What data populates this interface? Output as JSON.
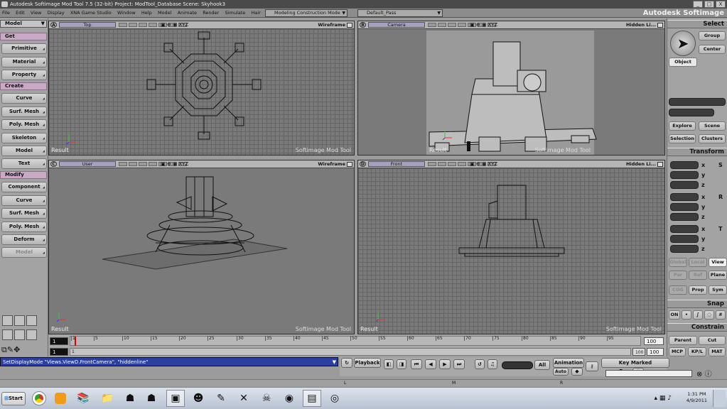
{
  "window": {
    "title": "Autodesk Softimage Mod Tool 7.5 (32-bit)    Project: ModTool_Database    Scene: Skyhook3",
    "brand": "Autodesk Softimage",
    "controls": [
      "_",
      "□",
      "X"
    ]
  },
  "menu": [
    "File",
    "Edit",
    "View",
    "Display",
    "XNA Game Studio",
    "Window",
    "Help",
    "Model",
    "Animate",
    "Render",
    "Simulate",
    "Hair"
  ],
  "mode_dropdown": "Modeling Construction Mode",
  "pass_dropdown": "Default_Pass",
  "left_panel": {
    "mode": "Model",
    "sections": [
      {
        "title": "Get",
        "buttons": [
          "Primitive",
          "Material",
          "Property"
        ]
      },
      {
        "title": "Create",
        "buttons": [
          "Curve",
          "Surf. Mesh",
          "Poly. Mesh",
          "Skeleton",
          "Model",
          "Text"
        ]
      },
      {
        "title": "Modify",
        "buttons": [
          "Component",
          "Curve",
          "Surf. Mesh",
          "Poly. Mesh",
          "Deform",
          "Model"
        ]
      }
    ]
  },
  "viewports": [
    {
      "letter": "A",
      "camera": "Top",
      "mode": "Wireframe",
      "result": "Result",
      "watermark": "Softimage Mod Tool"
    },
    {
      "letter": "B",
      "camera": "Camera",
      "mode": "Hidden Li...",
      "result": "Result",
      "watermark": "Softimage Mod Tool"
    },
    {
      "letter": "C",
      "camera": "User",
      "mode": "Wireframe",
      "result": "Result",
      "watermark": "Softimage Mod Tool"
    },
    {
      "letter": "D",
      "camera": "Front",
      "mode": "Hidden Li...",
      "result": "Result",
      "watermark": "Softimage Mod Tool"
    }
  ],
  "viewport_icons": "XYZ",
  "right_panel": {
    "select_title": "Select",
    "select_buttons": [
      "Group",
      "Center"
    ],
    "object_btn": "Object",
    "explore": "Explore",
    "scene": "Scene",
    "selection": "Selection",
    "clusters": "Clusters",
    "transform_title": "Transform",
    "axes": [
      "x",
      "y",
      "z"
    ],
    "transform_keys": [
      "S",
      "R",
      "T"
    ],
    "coord_buttons": [
      "Global",
      "Local",
      "View"
    ],
    "coord_buttons2": [
      "Par",
      "Ref",
      "Plane"
    ],
    "coord_buttons3": [
      "COG",
      "Prop",
      "Sym"
    ],
    "snap_title": "Snap",
    "snap_on": "ON",
    "constrain_title": "Constrain",
    "constrain_buttons": [
      "Parent",
      "Cut",
      "MCP",
      "KP/L",
      "MAT"
    ]
  },
  "timeline": {
    "start": "1",
    "end": "100",
    "ticks": [
      "1",
      "5",
      "10",
      "15",
      "20",
      "25",
      "30",
      "35",
      "40",
      "45",
      "50",
      "55",
      "60",
      "65",
      "70",
      "75",
      "80",
      "85",
      "90",
      "95"
    ],
    "frame_start": "1",
    "frame_end": "100",
    "current": "1",
    "range_end": "100"
  },
  "command_line": "SetDisplayMode \"Views.ViewD.FrontCamera\", \"hiddenline\"",
  "playbar": {
    "playback": "Playback",
    "all": "All",
    "animation": "Animation",
    "auto": "Auto",
    "key_marked": "Key Marked Parameters"
  },
  "lmr": [
    "L",
    "M",
    "R"
  ],
  "taskbar": {
    "start": "Start",
    "time": "1:31 PM",
    "date": "4/9/2011"
  }
}
